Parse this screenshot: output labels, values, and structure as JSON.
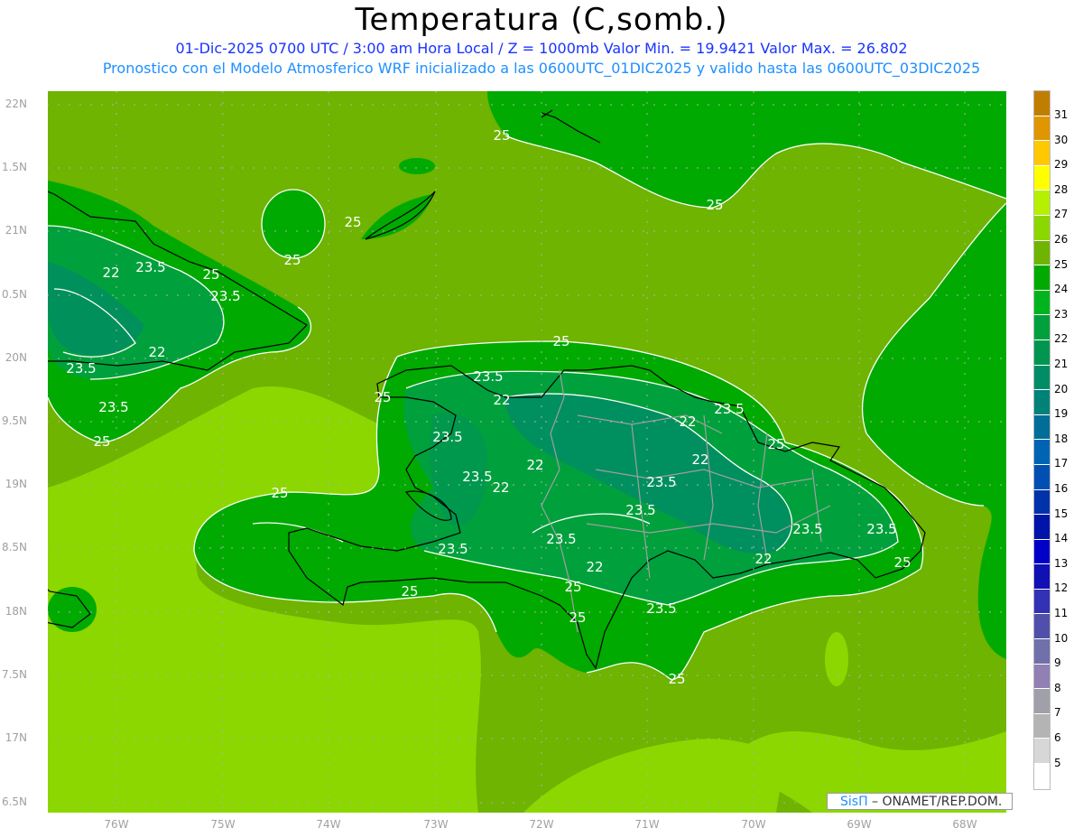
{
  "header": {
    "title": "Temperatura (C,somb.)",
    "subtitle": "01-Dic-2025  0700 UTC / 3:00 am Hora Local / Z = 1000mb    Valor Min. = 19.9421  Valor Max. = 26.802",
    "forecast_info": "Pronostico con el Modelo Atmosferico WRF inicializado a las 0600UTC_01DIC2025 y valido hasta las  0600UTC_03DIC2025"
  },
  "axes": {
    "lat_labels": [
      "22N",
      "1.5N",
      "21N",
      "0.5N",
      "20N",
      "9.5N",
      "19N",
      "8.5N",
      "18N",
      "7.5N",
      "17N",
      "6.5N"
    ],
    "lon_labels": [
      "76W",
      "75W",
      "74W",
      "73W",
      "72W",
      "71W",
      "70W",
      "69W",
      "68W"
    ]
  },
  "colorbar": {
    "labels": [
      "31",
      "30",
      "29",
      "28",
      "27",
      "26",
      "25",
      "24",
      "23",
      "22",
      "21",
      "20",
      "19",
      "18",
      "17",
      "16",
      "15",
      "14",
      "13",
      "12",
      "11",
      "10",
      "9",
      "8",
      "7",
      "6",
      "5"
    ],
    "colors": [
      "#c07e00",
      "#e09600",
      "#ffc800",
      "#ffff00",
      "#b4f000",
      "#8cd700",
      "#6eb400",
      "#00aa00",
      "#00b41e",
      "#00a03c",
      "#009650",
      "#008c64",
      "#008278",
      "#006e96",
      "#0064b4",
      "#0050b4",
      "#0032aa",
      "#0014aa",
      "#0000c8",
      "#1010b4",
      "#3232b4",
      "#5050aa",
      "#7070aa",
      "#9080b4",
      "#a0a0aa",
      "#b4b4b4",
      "#d7d7d7",
      "#ffffff"
    ]
  },
  "contour_labels": [
    "25",
    "25",
    "25",
    "25",
    "25",
    "25",
    "25",
    "25",
    "25",
    "25",
    "25",
    "25",
    "25",
    "25",
    "25",
    "23.5",
    "23.5",
    "23.5",
    "23.5",
    "23.5",
    "23.5",
    "23.5",
    "23.5",
    "23.5",
    "23.5",
    "23.5",
    "23.5",
    "23.5",
    "23.5",
    "23.5",
    "22",
    "22",
    "22",
    "22",
    "22",
    "22",
    "22",
    "22",
    "22"
  ],
  "credit": {
    "brand": "SisΠ",
    "text": " – ONAMET/REP.DOM."
  }
}
